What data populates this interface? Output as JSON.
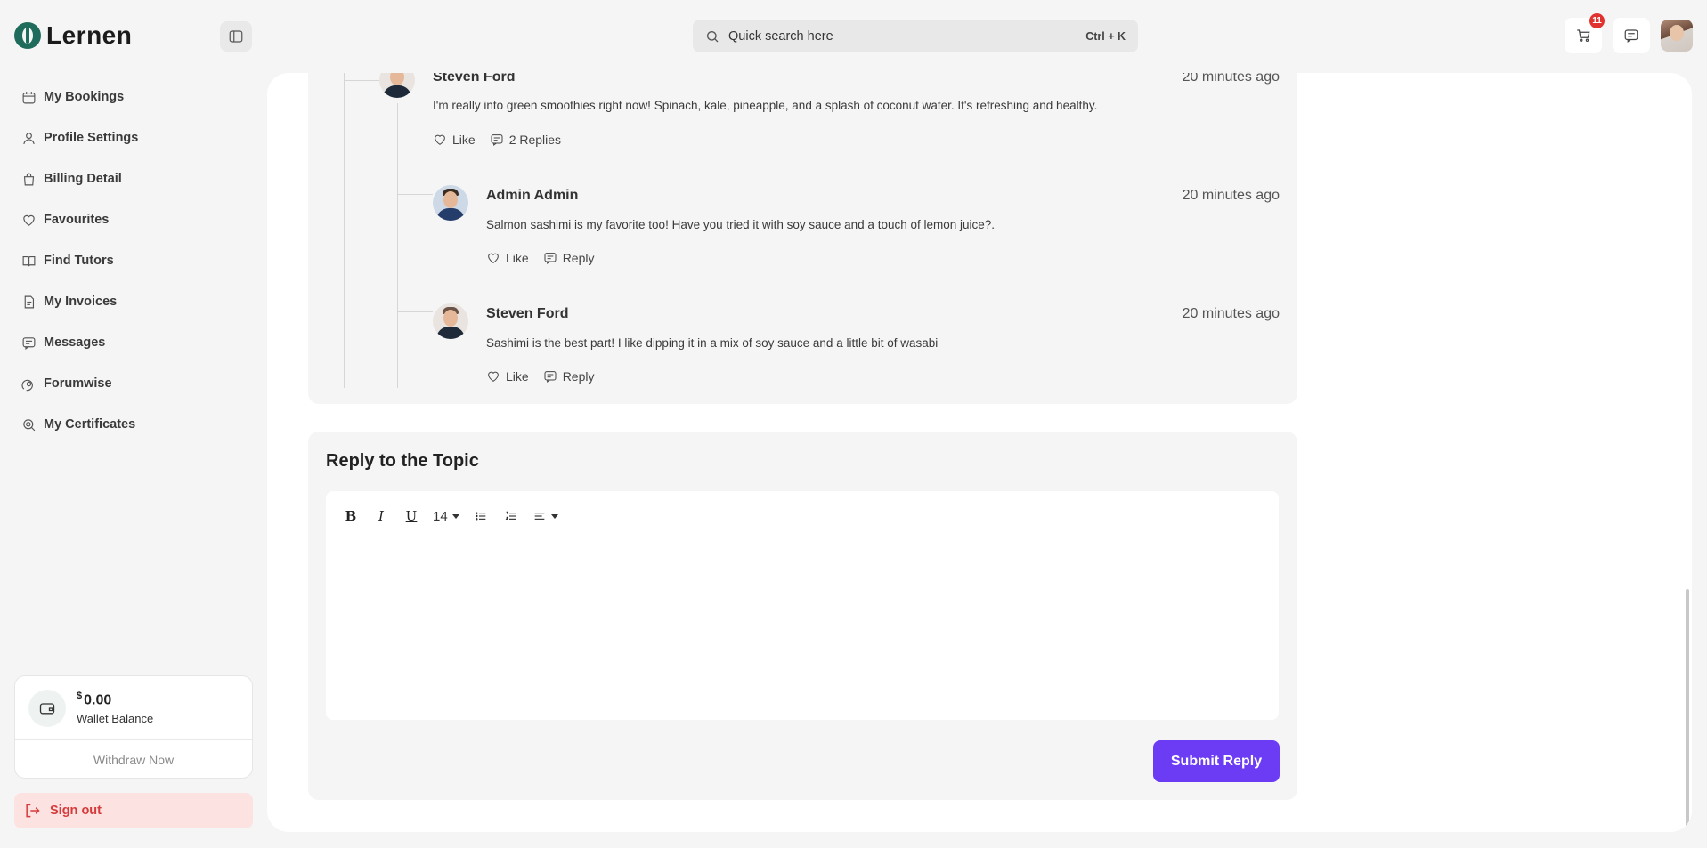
{
  "brand": {
    "name": "Lernen"
  },
  "sidebar": {
    "items": [
      {
        "label": "My Bookings",
        "icon": "calendar-icon"
      },
      {
        "label": "Profile Settings",
        "icon": "user-icon"
      },
      {
        "label": "Billing Detail",
        "icon": "bag-icon"
      },
      {
        "label": "Favourites",
        "icon": "heart-icon"
      },
      {
        "label": "Find Tutors",
        "icon": "book-icon"
      },
      {
        "label": "My Invoices",
        "icon": "invoice-icon"
      },
      {
        "label": "Messages",
        "icon": "message-icon"
      },
      {
        "label": "Forumwise",
        "icon": "forum-icon"
      },
      {
        "label": "My Certificates",
        "icon": "certificate-icon"
      }
    ],
    "wallet": {
      "currency": "$",
      "amount": "0.00",
      "label": "Wallet Balance",
      "action": "Withdraw Now"
    },
    "signout": "Sign out"
  },
  "header": {
    "search_placeholder": "Quick search here",
    "search_shortcut": "Ctrl + K",
    "cart_count": "11"
  },
  "thread": {
    "parent": {
      "author": "Steven Ford",
      "time": "20 minutes ago",
      "text": "I'm really into green smoothies right now! Spinach, kale, pineapple, and a splash of coconut water. It's refreshing and healthy.",
      "like_label": "Like",
      "replies_label": "2 Replies"
    },
    "replies": [
      {
        "author": "Admin Admin",
        "time": "20 minutes ago",
        "text": "Salmon sashimi is my favorite too! Have you tried it with soy sauce and a touch of lemon juice?.",
        "like_label": "Like",
        "reply_label": "Reply"
      },
      {
        "author": "Steven Ford",
        "time": "20 minutes ago",
        "text": "Sashimi is the best part! I like dipping it in a mix of soy sauce and a little bit of wasabi",
        "like_label": "Like",
        "reply_label": "Reply"
      }
    ]
  },
  "reply_form": {
    "title": "Reply to the Topic",
    "toolbar": {
      "bold": "B",
      "italic": "I",
      "underline": "U",
      "font_size": "14"
    },
    "submit_label": "Submit Reply"
  }
}
